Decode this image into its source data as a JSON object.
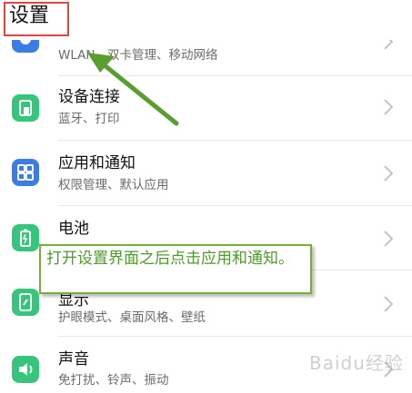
{
  "header": {
    "title": "设置"
  },
  "rows": [
    {
      "title": "",
      "subtitle": "WLAN、双卡管理、移动网络",
      "icon": "network-icon",
      "color": "#3b7de6"
    },
    {
      "title": "设备连接",
      "subtitle": "蓝牙、打印",
      "icon": "device-connect-icon",
      "color": "#37c47b"
    },
    {
      "title": "应用和通知",
      "subtitle": "权限管理、默认应用",
      "icon": "apps-grid-icon",
      "color": "#3b7de6"
    },
    {
      "title": "电池",
      "subtitle": "",
      "icon": "battery-icon",
      "color": "#37c47b"
    },
    {
      "title": "显示",
      "subtitle": "护眼模式、桌面风格、壁纸",
      "icon": "display-icon",
      "color": "#37c47b"
    },
    {
      "title": "声音",
      "subtitle": "免打扰、铃声、振动",
      "icon": "sound-icon",
      "color": "#37c47b"
    }
  ],
  "callout": {
    "text": "打开设置界面之后点击应用和通知。"
  },
  "watermark": "Baidu经验",
  "colors": {
    "accent_red": "#e0463b",
    "arrow_green": "#5a9e2f",
    "callout_green": "#78ad3a"
  }
}
